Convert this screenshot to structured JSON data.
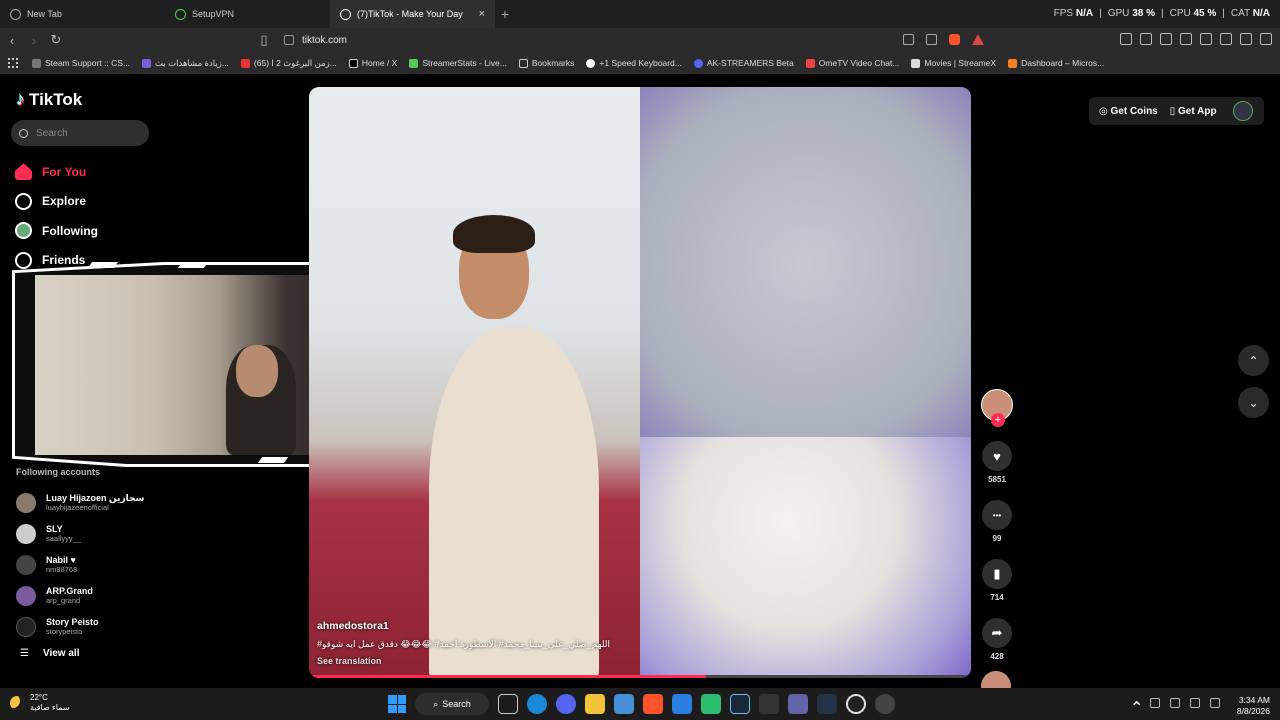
{
  "browser": {
    "tabs": [
      {
        "title": "New Tab",
        "active": false
      },
      {
        "title": "SetupVPN",
        "active": false
      },
      {
        "title": "(7)TikTok - Make Your Day",
        "active": true
      }
    ],
    "new_tab": "+",
    "close": "×",
    "stats": [
      {
        "label": "FPS",
        "value": "N/A"
      },
      {
        "label": "GPU",
        "value": "38 %"
      },
      {
        "label": "CPU",
        "value": "45 %"
      },
      {
        "label": "CAT",
        "value": "N/A"
      }
    ],
    "url": "tiktok.com",
    "bookmarks": [
      "Steam Support :: CS...",
      "زيادة مشاهدات بث...",
      "(65) زمن البرغوث 2 ا...",
      "Home / X",
      "StreamerStats - Live...",
      "Bookmarks",
      "+1 Speed Keyboard...",
      "AK-STREAMERS Beta",
      "OmeTV Video Chat...",
      "Movies | StreameX",
      "Dashboard – Micros..."
    ]
  },
  "tiktok": {
    "logo": "TikTok",
    "search_placeholder": "Search",
    "nav": [
      {
        "label": "For You",
        "active": true
      },
      {
        "label": "Explore",
        "active": false
      },
      {
        "label": "Following",
        "active": false
      },
      {
        "label": "Friends",
        "active": false
      }
    ],
    "following_title": "Following accounts",
    "accounts": [
      {
        "name": "Luay Hijazoen سجازين",
        "user": "luayhijazeenofficial"
      },
      {
        "name": "SLY",
        "user": "saallyyy__"
      },
      {
        "name": "Nabil ♥",
        "user": "nm98768"
      },
      {
        "name": "ARP.Grand",
        "user": "arp_grand"
      },
      {
        "name": "Story Peisto",
        "user": "storypeisto"
      }
    ],
    "view_all": "View all",
    "get_coins": "Get Coins",
    "get_app": "Get App",
    "video": {
      "author": "ahmedostora1",
      "description": "اللهم_صلي_على_نبينا_محمد# الاسطورة احمد# 😂😂😂 دقدق عمل ايه شوقو#",
      "see_translation": "See translation",
      "progress": 0.6
    },
    "actions": [
      {
        "icon": "heart-icon",
        "glyph": "♥",
        "count": "5851"
      },
      {
        "icon": "comment-icon",
        "glyph": "•••",
        "count": "99"
      },
      {
        "icon": "bookmark-icon",
        "glyph": "▮",
        "count": "714"
      },
      {
        "icon": "share-icon",
        "glyph": "➦",
        "count": "428"
      }
    ],
    "follow_plus": "+",
    "up_arrow": "⌃",
    "down_arrow": "⌄"
  },
  "taskbar": {
    "temperature": "22°C",
    "weather_text": "سماء صافية",
    "search": "Search",
    "time": "3:34 AM",
    "date": "8/8/2026"
  },
  "colors": {
    "accent": "#fe2c55",
    "background": "#000000"
  }
}
